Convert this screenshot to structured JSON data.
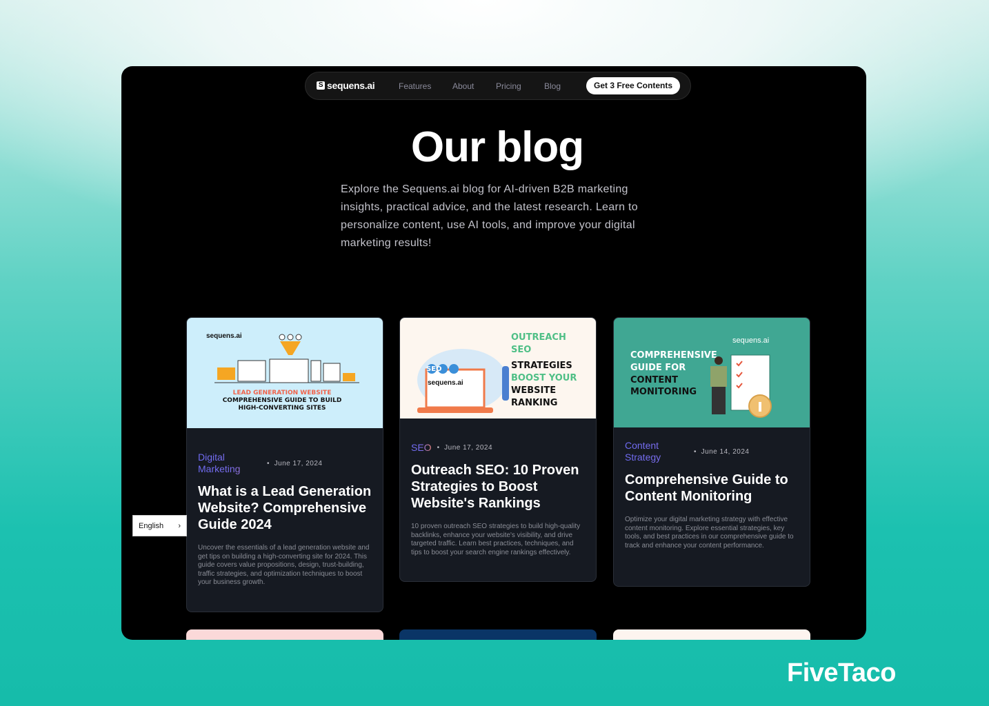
{
  "nav": {
    "brand": "sequens.ai",
    "items": [
      "Features",
      "About",
      "Pricing",
      "Blog"
    ],
    "cta": "Get 3 Free Contents"
  },
  "hero": {
    "title": "Our blog",
    "intro": "Explore the Sequens.ai blog for AI-driven B2B marketing insights, practical advice, and the latest research. Learn to personalize content, use AI tools, and improve your digital marketing results!"
  },
  "posts": [
    {
      "category": "Digital Marketing",
      "date": "June 17, 2024",
      "title": "What is a Lead Generation Website? Comprehensive Guide 2024",
      "excerpt": "Uncover the essentials of a lead generation website and get tips on building a high-converting site for 2024. This guide covers value propositions, design, trust-building, traffic strategies, and optimization techniques to boost your business growth.",
      "image_text": {
        "brand": "sequens.ai",
        "l1": "LEAD GENERATION WEBSITE",
        "l2": "COMPREHENSIVE GUIDE TO BUILD",
        "l3": "HIGH-CONVERTING SITES"
      }
    },
    {
      "category": "SEO",
      "date": "June 17, 2024",
      "title": "Outreach SEO: 10 Proven Strategies to Boost Website's Rankings",
      "excerpt": "10 proven outreach SEO strategies to build high-quality backlinks, enhance your website's visibility, and drive targeted traffic. Learn best practices, techniques, and tips to boost your search engine rankings effectively.",
      "image_text": {
        "brand": "sequens.ai",
        "badge": "SEO",
        "l1": "OUTREACH",
        "l2": "SEO",
        "l3": "STRATEGIES",
        "l4": "BOOST YOUR",
        "l5": "WEBSITE",
        "l6": "RANKING"
      }
    },
    {
      "category": "Content Strategy",
      "date": "June 14, 2024",
      "title": "Comprehensive Guide to Content Monitoring",
      "excerpt": "Optimize your digital marketing strategy with effective content monitoring. Explore essential strategies, key tools, and best practices in our comprehensive guide to track and enhance your content performance.",
      "image_text": {
        "brand": "sequens.ai",
        "l1": "COMPREHENSIVE",
        "l2": "GUIDE FOR",
        "l3": "CONTENT",
        "l4": "MONITORING"
      }
    }
  ],
  "language": {
    "label": "English"
  },
  "watermark": "FiveTaco"
}
